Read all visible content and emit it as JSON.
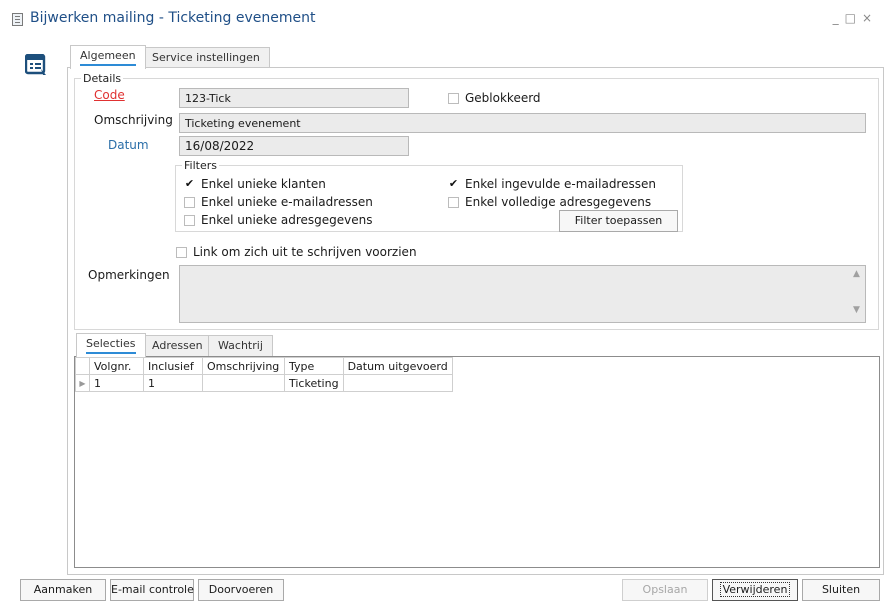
{
  "window": {
    "title": "Bijwerken mailing - Ticketing evenement",
    "controls": [
      "_",
      "□",
      "×"
    ]
  },
  "tabs": [
    {
      "label": "Algemeen",
      "active": true
    },
    {
      "label": "Service instellingen",
      "active": false
    }
  ],
  "details": {
    "legend": "Details",
    "code_label": "Code",
    "code_value": "123-Tick",
    "omschrijving_label": "Omschrijving",
    "omschrijving_value": "Ticketing evenement",
    "datum_label": "Datum",
    "datum_value": "16/08/2022",
    "geblokkeerd_label": "Geblokkeerd",
    "geblokkeerd_checked": false
  },
  "filters": {
    "legend": "Filters",
    "unieke_klanten": {
      "label": "Enkel unieke klanten",
      "checked": true
    },
    "unieke_emailadressen": {
      "label": "Enkel unieke e-mailadressen",
      "checked": false
    },
    "unieke_adresgegevens": {
      "label": "Enkel unieke adresgegevens",
      "checked": false
    },
    "ingevulde_emailadressen": {
      "label": "Enkel ingevulde e-mailadressen",
      "checked": true
    },
    "volledige_adresgegevens": {
      "label": "Enkel volledige adresgegevens",
      "checked": false
    },
    "apply_button": "Filter toepassen"
  },
  "unsubscribe": {
    "label": "Link om zich uit te schrijven voorzien",
    "checked": false
  },
  "remarks": {
    "label": "Opmerkingen",
    "value": ""
  },
  "subtabs": [
    {
      "label": "Selecties",
      "active": true
    },
    {
      "label": "Adressen",
      "active": false
    },
    {
      "label": "Wachtrij",
      "active": false
    }
  ],
  "grid": {
    "columns": [
      "Volgnr.",
      "Inclusief",
      "Omschrijving",
      "Type",
      "Datum uitgevoerd"
    ],
    "rows": [
      [
        "1",
        "1",
        "",
        "Ticketing",
        ""
      ]
    ]
  },
  "footer": {
    "aanmaken": "Aanmaken",
    "email_controle": "E-mail controle",
    "doorvoeren": "Doorvoeren",
    "opslaan": "Opslaan",
    "verwijderen": "Verwijderen",
    "sluiten": "Sluiten"
  },
  "colors": {
    "accent": "#2d8bd6",
    "title": "#1f4f87",
    "required": "#e03131",
    "link": "#2a6ea8"
  }
}
